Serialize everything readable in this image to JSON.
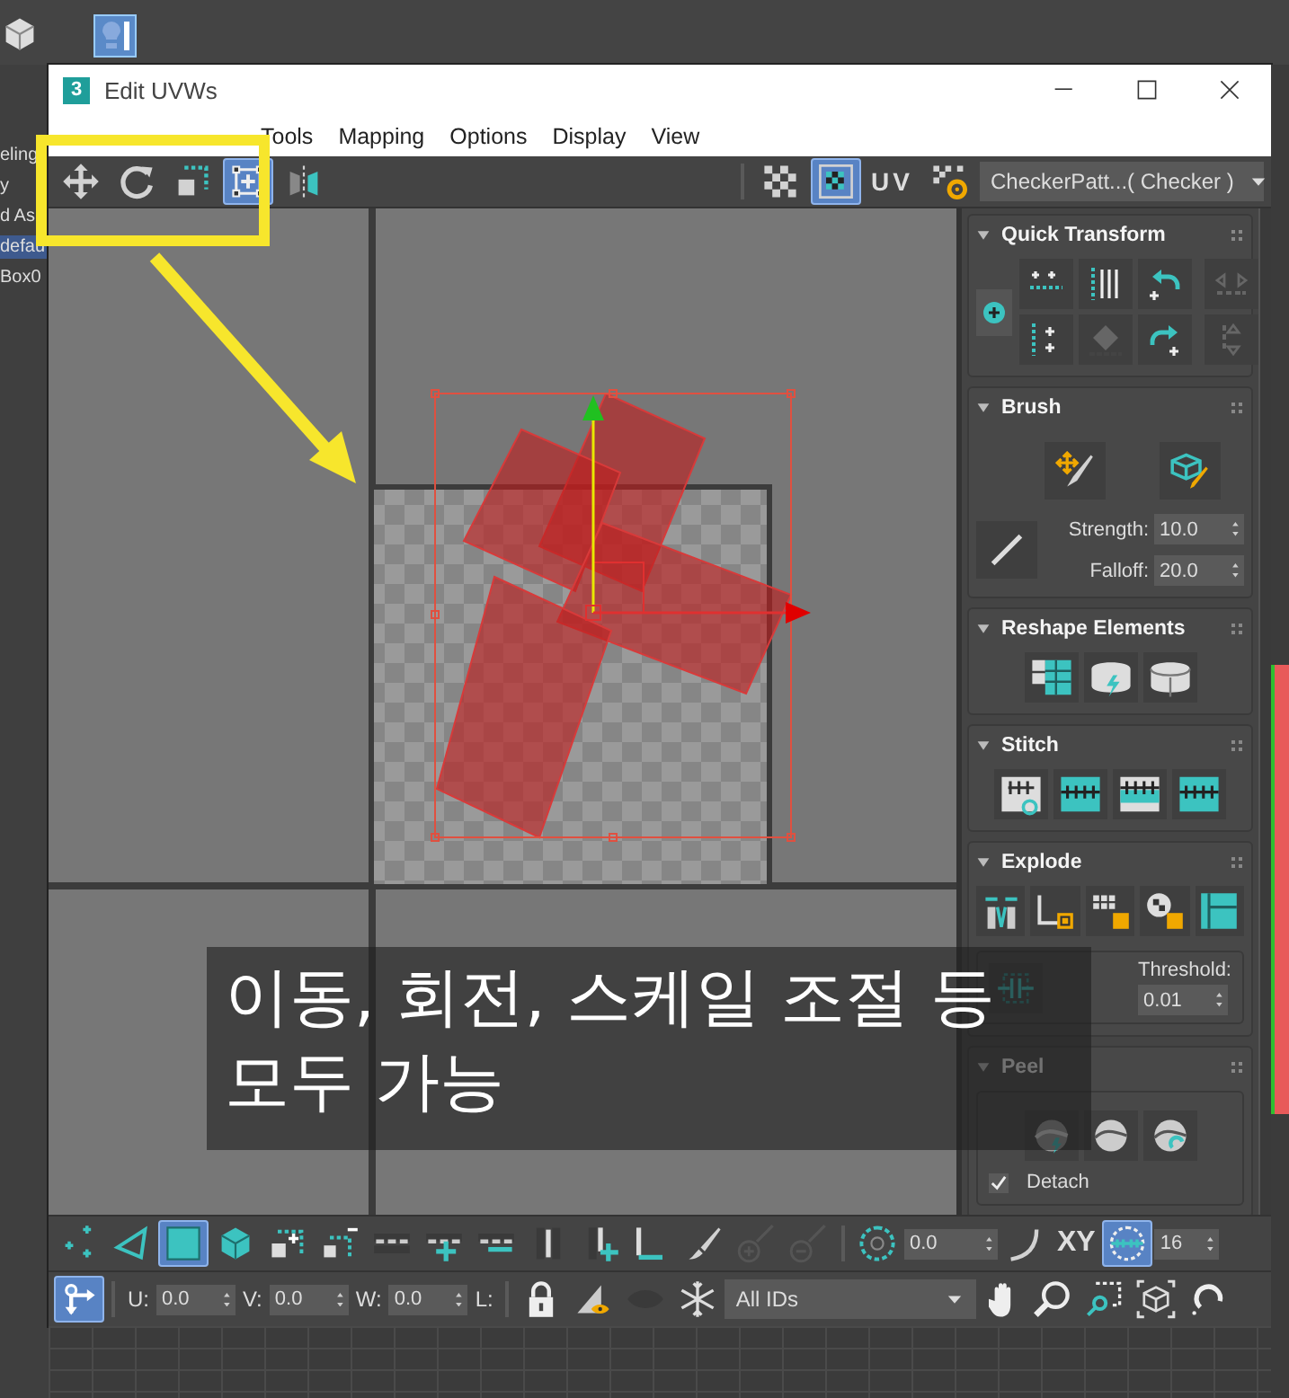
{
  "background_app": {
    "left_items": [
      {
        "text": "eling",
        "selected": false
      },
      {
        "text": "y",
        "selected": false
      },
      {
        "text": "d As",
        "selected": false
      },
      {
        "text": "defau",
        "selected": true
      },
      {
        "text": "Box0",
        "selected": false
      }
    ]
  },
  "window": {
    "logo": "3",
    "title": "Edit UVWs"
  },
  "menu": [
    "Tools",
    "Mapping",
    "Options",
    "Display",
    "View"
  ],
  "toolbar": {
    "tools": [
      {
        "kind": "move",
        "selected": false
      },
      {
        "kind": "rotate",
        "selected": false
      },
      {
        "kind": "scale",
        "selected": false
      },
      {
        "kind": "freeform",
        "selected": true
      },
      {
        "kind": "mirror",
        "selected": false
      }
    ],
    "show_map_on": true,
    "uv_label": "UV",
    "map_dropdown": "CheckerPatt...( Checker )"
  },
  "rollouts": [
    {
      "kind": "quick_transform",
      "title": "Quick Transform",
      "expanded": true
    },
    {
      "kind": "brush",
      "title": "Brush",
      "expanded": true,
      "strength_label": "Strength:",
      "strength": "10.0",
      "falloff_label": "Falloff:",
      "falloff": "20.0"
    },
    {
      "kind": "reshape",
      "title": "Reshape Elements",
      "expanded": true
    },
    {
      "kind": "stitch",
      "title": "Stitch",
      "expanded": true
    },
    {
      "kind": "explode",
      "title": "Explode",
      "expanded": true,
      "threshold_label": "Threshold:",
      "threshold": "0.01"
    },
    {
      "kind": "peel",
      "title": "Peel",
      "expanded": true,
      "detach": {
        "label": "Detach",
        "checked": true
      }
    }
  ],
  "caption": {
    "lines": [
      "이동, 회전, 스케일 조절 등",
      "모두 가능"
    ]
  },
  "bottom_toolbar": {
    "selection_modes": [
      {
        "kind": "vertex",
        "selected": false
      },
      {
        "kind": "edge",
        "selected": false
      },
      {
        "kind": "face",
        "selected": true
      },
      {
        "kind": "element",
        "selected": false
      }
    ],
    "rotation": "0.0",
    "axis_label": "XY",
    "snap_on": true,
    "snap_value": "16",
    "type_in_on": true,
    "coords": [
      {
        "label": "U:",
        "value": "0.0"
      },
      {
        "label": "V:",
        "value": "0.0"
      },
      {
        "label": "W:",
        "value": "0.0"
      },
      {
        "label": "L:"
      }
    ],
    "id_filter": "All IDs"
  }
}
